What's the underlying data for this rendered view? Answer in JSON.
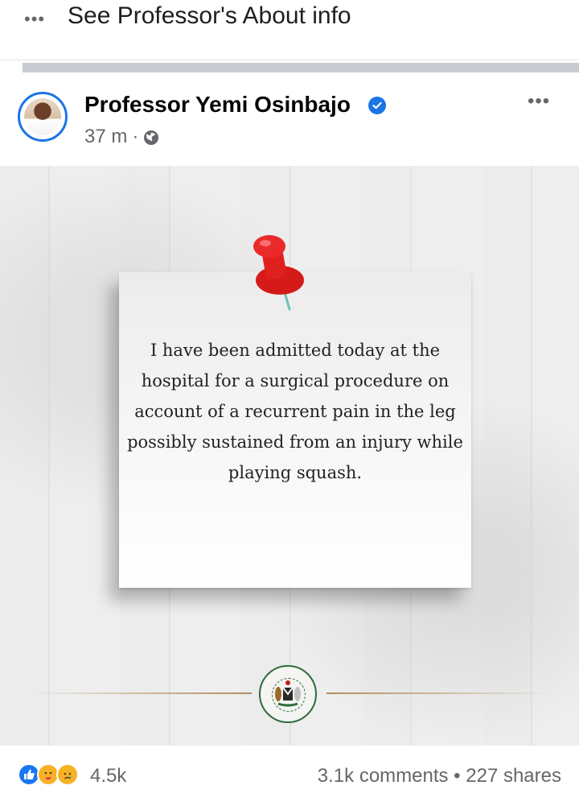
{
  "top_bar": {
    "more_icon": "more-horizontal-icon",
    "about_link": "See Professor's About info"
  },
  "post": {
    "author": "Professor Yemi Osinbajo",
    "verified_icon": "verified-badge-icon",
    "timestamp": "37 m",
    "separator": "·",
    "privacy_icon": "globe-icon",
    "more_icon": "more-horizontal-icon",
    "image": {
      "note_lines": [
        "I have been admitted today at the",
        "hospital for a surgical procedure on",
        "account of a recurrent pain in the leg",
        "possibly sustained from an injury while",
        "playing squash."
      ],
      "pin_icon": "push-pin-icon",
      "seal_icon": "vice-president-seal-icon"
    },
    "reactions": {
      "icons": [
        "like-reaction-icon",
        "care-reaction-icon",
        "sad-reaction-icon"
      ],
      "count": "4.5k"
    },
    "comments_shares": "3.1k comments • 227 shares"
  },
  "colors": {
    "accent": "#1b74e4",
    "muted_text": "#65676b",
    "pin_red": "#e0201f",
    "gold": "#b08e5a"
  }
}
